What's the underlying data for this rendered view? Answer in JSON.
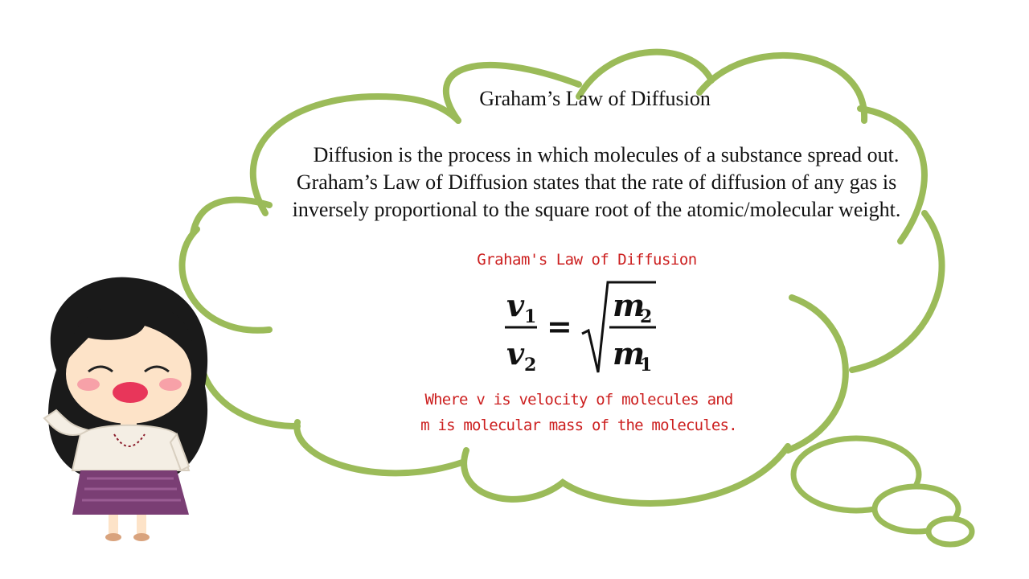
{
  "slide": {
    "title": "Graham’s Law of Diffusion",
    "body_lines": [
      "Diffusion is the process in which molecules of a substance spread out.",
      "Graham’s Law of Diffusion states that the rate of diffusion of any gas is",
      "inversely proportional to the square root of the atomic/molecular weight."
    ],
    "formula": {
      "title": "Graham's Law of Diffusion",
      "lhs_numerator": "v",
      "lhs_numerator_sub": "1",
      "lhs_denominator": "v",
      "lhs_denominator_sub": "2",
      "equals": "=",
      "rhs_numerator": "m",
      "rhs_numerator_sub": "2",
      "rhs_denominator": "m",
      "rhs_denominator_sub": "1"
    },
    "caption_lines": [
      "Where v is velocity of molecules and",
      "m is molecular mass of the molecules."
    ]
  },
  "colors": {
    "cloud_outline": "#9bbb59",
    "formula_text": "#cc1f1f",
    "body_text": "#111111"
  },
  "icons": {
    "character": "cartoon-girl-illustration"
  }
}
